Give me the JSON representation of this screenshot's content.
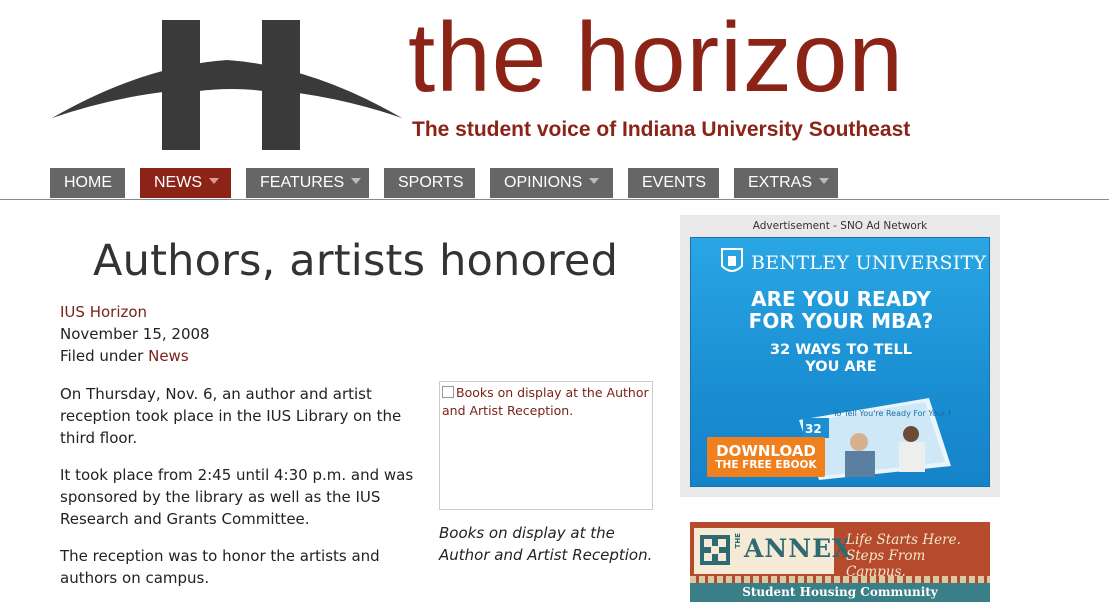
{
  "header": {
    "site_title": "the horizon",
    "tagline": "The student voice of Indiana University Southeast"
  },
  "nav": {
    "items": [
      {
        "label": "HOME",
        "dropdown": false
      },
      {
        "label": "NEWS",
        "dropdown": true,
        "active": true
      },
      {
        "label": "FEATURES",
        "dropdown": true
      },
      {
        "label": "SPORTS",
        "dropdown": false
      },
      {
        "label": "OPINIONS",
        "dropdown": true
      },
      {
        "label": "EVENTS",
        "dropdown": false
      },
      {
        "label": "EXTRAS",
        "dropdown": true
      }
    ]
  },
  "article": {
    "headline": "Authors, artists honored",
    "author": "IUS Horizon",
    "date": "November 15, 2008",
    "filed_under_prefix": "Filed under",
    "category": "News",
    "paragraphs": [
      "On Thursday, Nov. 6, an author and artist reception took place in the IUS Library on the third floor.",
      "It took place from 2:45 until 4:30 p.m. and was sponsored by the library as well as the IUS Research and Grants Committee.",
      "The reception was to honor the artists and authors on campus."
    ],
    "image_alt": "Books on display at the Author and Artist Reception.",
    "caption": "Books on display at the Author and Artist Reception."
  },
  "sidebar": {
    "ad_label": "Advertisement - SNO Ad Network",
    "ad1": {
      "brand": "BENTLEY UNIVERSITY",
      "headline_line1": "ARE YOU READY",
      "headline_line2": "FOR YOUR MBA?",
      "sub_line1": "32 WAYS TO TELL",
      "sub_line2": "YOU ARE",
      "button_line1": "DOWNLOAD",
      "button_line2": "THE FREE EBOOK",
      "book_number": "32",
      "book_title": "To Tell You're Ready For Your MBA"
    },
    "ad2": {
      "logo_the": "THE",
      "logo_name": "ANNEX",
      "slogan_line1": "Life Starts Here.",
      "slogan_line2": "Steps From Campus.",
      "bottom_text": "Student Housing Community"
    }
  }
}
